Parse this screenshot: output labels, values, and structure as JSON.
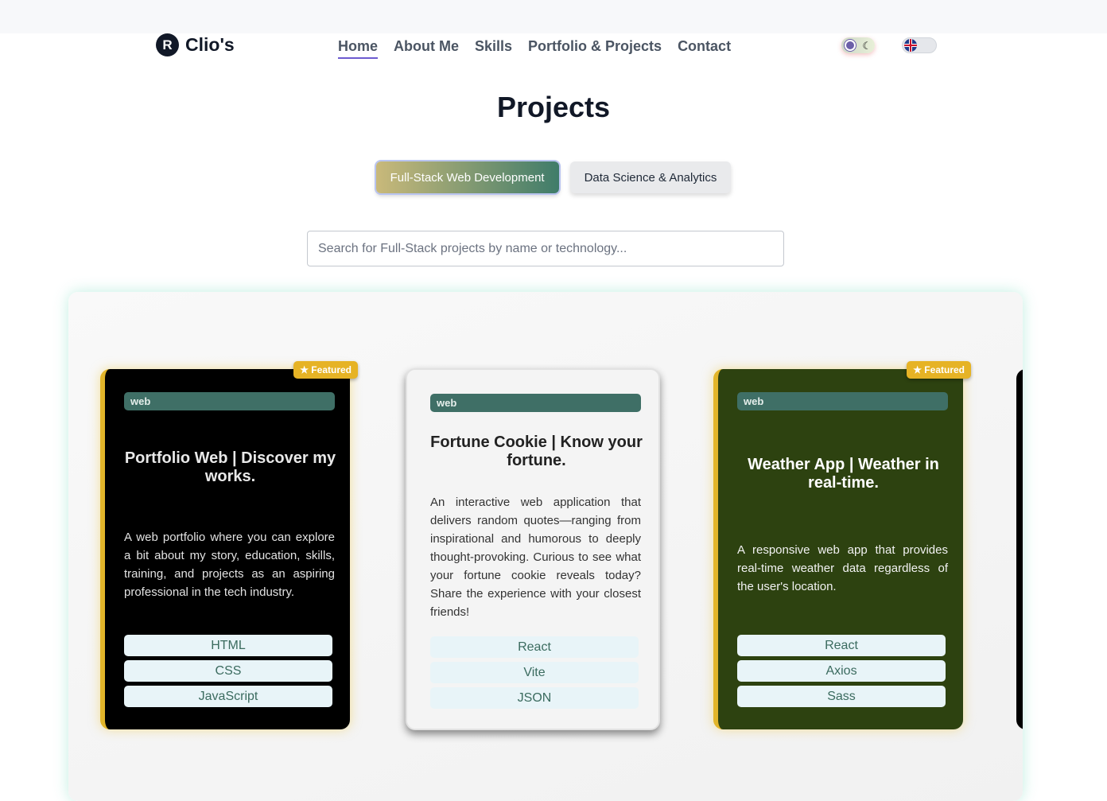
{
  "header": {
    "logo_letter": "R",
    "logo_text": "Clio's",
    "nav": [
      {
        "label": "Home"
      },
      {
        "label": "About Me"
      },
      {
        "label": "Skills"
      },
      {
        "label": "Portfolio & Projects"
      },
      {
        "label": "Contact"
      }
    ]
  },
  "page": {
    "title": "Projects"
  },
  "tabs": [
    {
      "label": "Full-Stack Web Development",
      "active": true
    },
    {
      "label": "Data Science & Analytics",
      "active": false
    }
  ],
  "search": {
    "placeholder": "Search for Full-Stack projects by name or technology..."
  },
  "cards": [
    {
      "featured": "★ Featured",
      "tag": "web",
      "title": "Portfolio Web | Discover my works.",
      "description": "A web portfolio where you can explore a bit about my story, education, skills, training, and projects as an aspiring professional in the tech industry.",
      "techs": [
        "HTML",
        "CSS",
        "JavaScript"
      ]
    },
    {
      "tag": "web",
      "title": "Fortune Cookie | Know your fortune.",
      "description": "An interactive web application that delivers random quotes—ranging from inspirational and humorous to deeply thought-provoking. Curious to see what your fortune cookie reveals today? Share the experience with your closest friends!",
      "techs": [
        "React",
        "Vite",
        "JSON"
      ]
    },
    {
      "featured": "★ Featured",
      "tag": "web",
      "title": "Weather App | Weather in real-time.",
      "description": "A responsive web app that provides real-time weather data regardless of the user's location.",
      "techs": [
        "React",
        "Axios",
        "Sass"
      ]
    }
  ],
  "colors": {
    "accent_purple": "#6d5bd0",
    "tag_green": "#3f6f66",
    "featured_gold": "#e6b325",
    "card_dark": "#000000",
    "card_green": "#2d4210"
  },
  "icons": [
    "sun-icon",
    "moon-icon",
    "uk-flag-icon"
  ]
}
